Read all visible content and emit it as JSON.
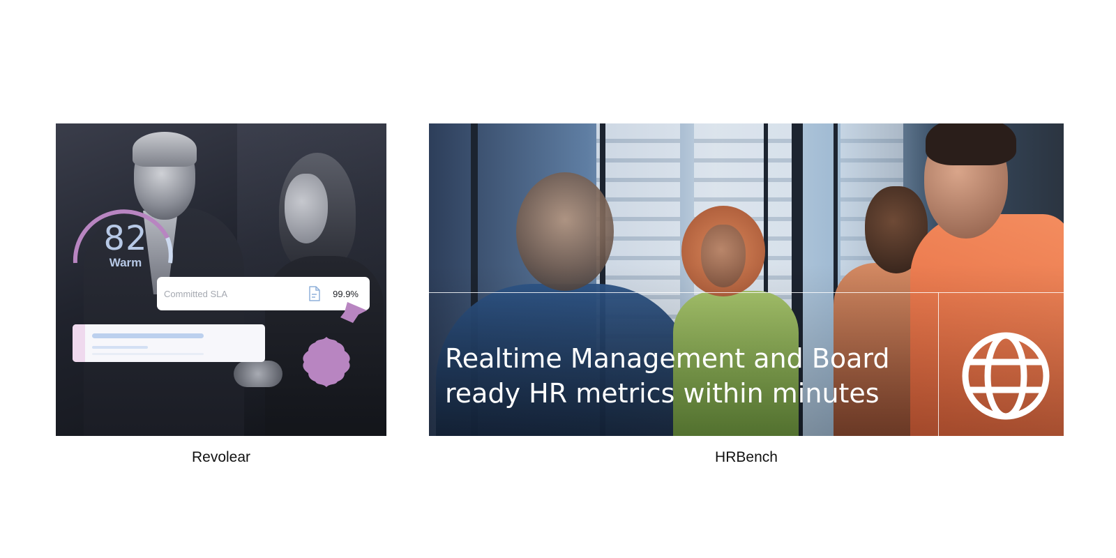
{
  "cards": [
    {
      "caption": "Revolear",
      "gauge": {
        "value": "82",
        "label": "Warm"
      },
      "sla": {
        "label": "Committed SLA",
        "value": "99.9%",
        "icon": "document-icon"
      },
      "colors": {
        "accent": "#b885c1",
        "gauge_text": "#b7c9e6"
      }
    },
    {
      "caption": "HRBench",
      "headline_line1": "Realtime Management and Board",
      "headline_line2": "ready HR metrics within minutes",
      "icon": "globe-icon",
      "colors": {
        "text": "#ffffff"
      }
    }
  ]
}
